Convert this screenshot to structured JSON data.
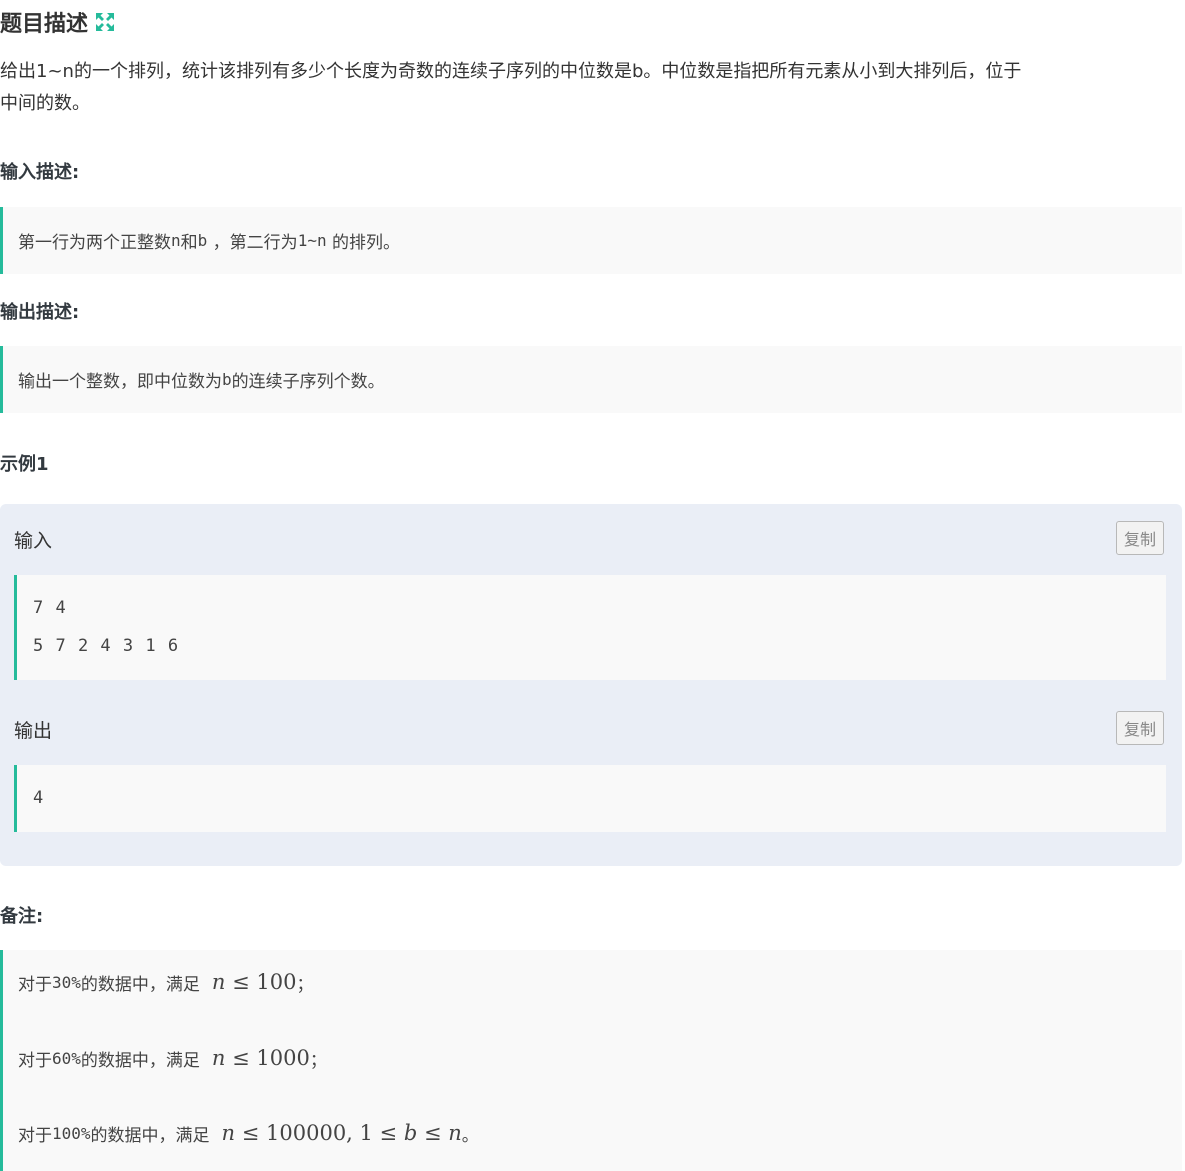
{
  "title": "题目描述",
  "icons": {
    "expand": "expand-arrows-icon",
    "accent_color": "#25bb9b"
  },
  "description": {
    "line1": "给出1~n的一个排列，统计该排列有多少个长度为奇数的连续子序列的中位数是b。中位数是指把所有元素从小到大排列后，位于",
    "line2": "中间的数。"
  },
  "input_section": {
    "heading": "输入描述:",
    "parts": [
      "第一行为两个正整数",
      "n",
      "和",
      "b",
      " ，第二行为",
      "1~n",
      " 的排列。"
    ]
  },
  "output_section": {
    "heading": "输出描述:",
    "parts": [
      "输出一个整数，即中位数为",
      "b",
      "的连续子序列个数。"
    ]
  },
  "example": {
    "heading": "示例1",
    "input_label": "输入",
    "output_label": "输出",
    "copy_label": "复制",
    "input_lines": [
      "7 4",
      "5 7 2 4 3 1 6"
    ],
    "output_lines": [
      "4"
    ]
  },
  "notes": {
    "heading": "备注:",
    "rows": [
      {
        "prefix": "对于",
        "pct": "30%",
        "mid": "的数据中，满足",
        "math": [
          "n",
          " ≤ 100"
        ],
        "tail": "；"
      },
      {
        "prefix": "对于",
        "pct": "60%",
        "mid": "的数据中，满足",
        "math": [
          "n",
          " ≤ 1000"
        ],
        "tail": "；"
      },
      {
        "prefix": "对于",
        "pct": "100%",
        "mid": "的数据中，满足",
        "math": [
          "n",
          " ≤ 100000, 1 ≤ ",
          "b",
          " ≤ ",
          "n"
        ],
        "tail": "。"
      }
    ]
  }
}
